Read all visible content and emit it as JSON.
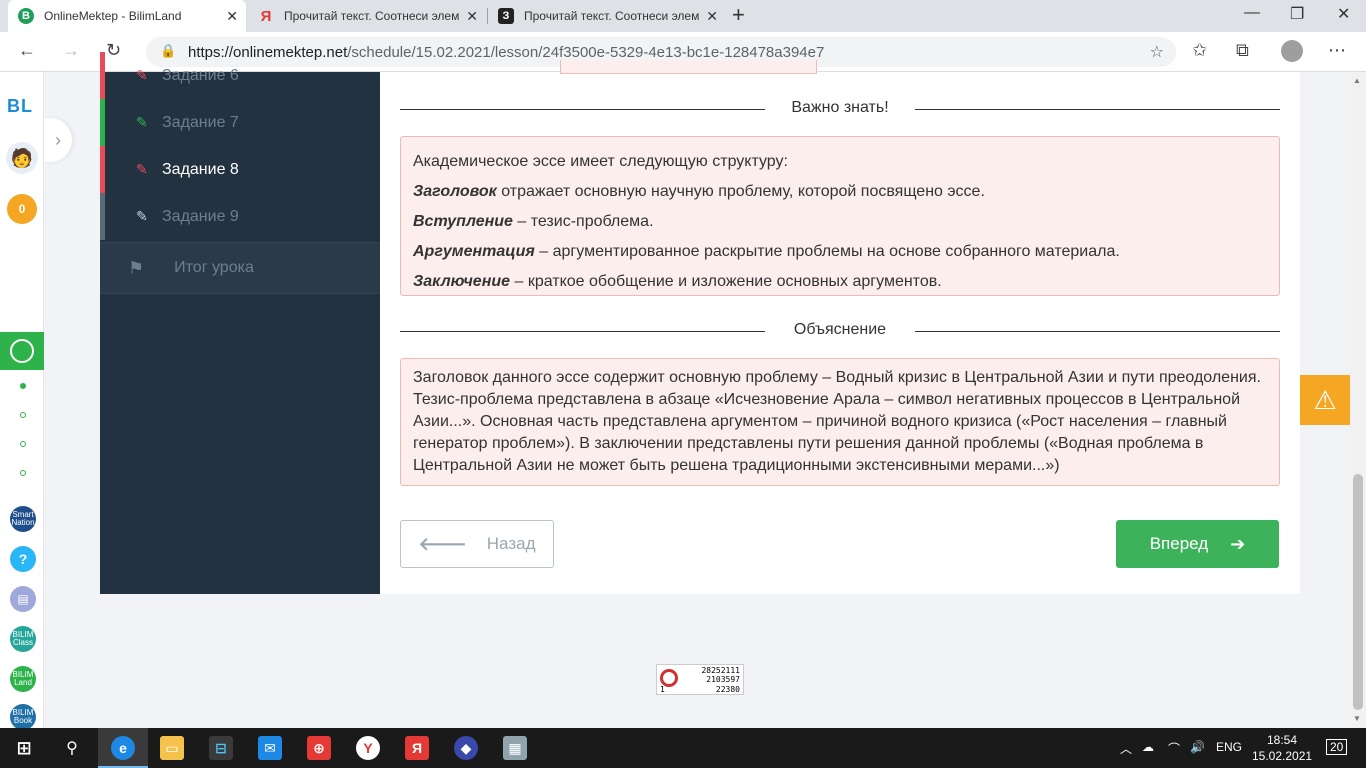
{
  "browser": {
    "tabs": [
      {
        "title": "OnlineMektep - BilimLand",
        "icon_letter": "B",
        "icon_color": "#1e9e5a",
        "active": true
      },
      {
        "title": "Прочитай текст. Соотнеси элем",
        "icon_letter": "Я",
        "icon_color": "#e53935",
        "active": false
      },
      {
        "title": "Прочитай текст. Соотнеси элем",
        "icon_letter": "З",
        "icon_color": "#222222",
        "active": false
      }
    ],
    "url_host": "https://onlinemektep.net",
    "url_path": "/schedule/15.02.2021/lesson/24f3500e-5329-4e13-bc1e-128478a394e7"
  },
  "rail": {
    "logo": "BL",
    "coins": "0",
    "apps": [
      {
        "label": "Smart Nation",
        "color": "#1f4e8c"
      },
      {
        "label": "?",
        "color": "#29b6f6"
      },
      {
        "label": "▤",
        "color": "#9fa8da"
      },
      {
        "label": "BILIM Class",
        "color": "#26a69a"
      },
      {
        "label": "BILIM Land",
        "color": "#2db34a"
      },
      {
        "label": "BILIM Book",
        "color": "#1f6fa8"
      }
    ]
  },
  "lesson_nav": {
    "tasks": [
      {
        "label": "Задание 6",
        "state": "red"
      },
      {
        "label": "Задание 7",
        "state": "green"
      },
      {
        "label": "Задание 8",
        "state": "red",
        "current": true
      },
      {
        "label": "Задание 9",
        "state": "grey"
      }
    ],
    "summary": "Итог урока"
  },
  "important": {
    "heading": "Важно знать!",
    "intro": "Академическое эссе имеет следующую структуру:",
    "items": [
      {
        "term": "Заголовок",
        "text": " отражает основную научную проблему, которой посвящено эссе."
      },
      {
        "term": "Вступление",
        "text": " – тезис-проблема."
      },
      {
        "term": "Аргументация",
        "text": " – аргументированное раскрытие проблемы на основе собранного материала."
      },
      {
        "term": "Заключение",
        "text": " – краткое обобщение и изложение основных аргументов."
      }
    ]
  },
  "explanation": {
    "heading": "Объяснение",
    "text": "Заголовок данного эссе содержит основную проблему – Водный кризис в Центральной Азии и пути преодоления. Тезис-проблема представлена в абзаце «Исчезновение Арала – символ негативных процессов в Центральной Азии...». Основная часть представлена аргументом – причиной водного кризиса («Рост населения – главный генератор проблем»). В заключении представлены пути решения данной проблемы («Водная проблема в Центральной Азии не может быть решена традиционными экстенсивными мерами...»)"
  },
  "buttons": {
    "back": "Назад",
    "next": "Вперед"
  },
  "counter": {
    "line1": "28252111",
    "line2": "2103597",
    "line3": "22380",
    "mark": "1"
  },
  "taskbar": {
    "lang": "ENG",
    "time": "18:54",
    "date": "15.02.2021",
    "notifications": "20"
  }
}
